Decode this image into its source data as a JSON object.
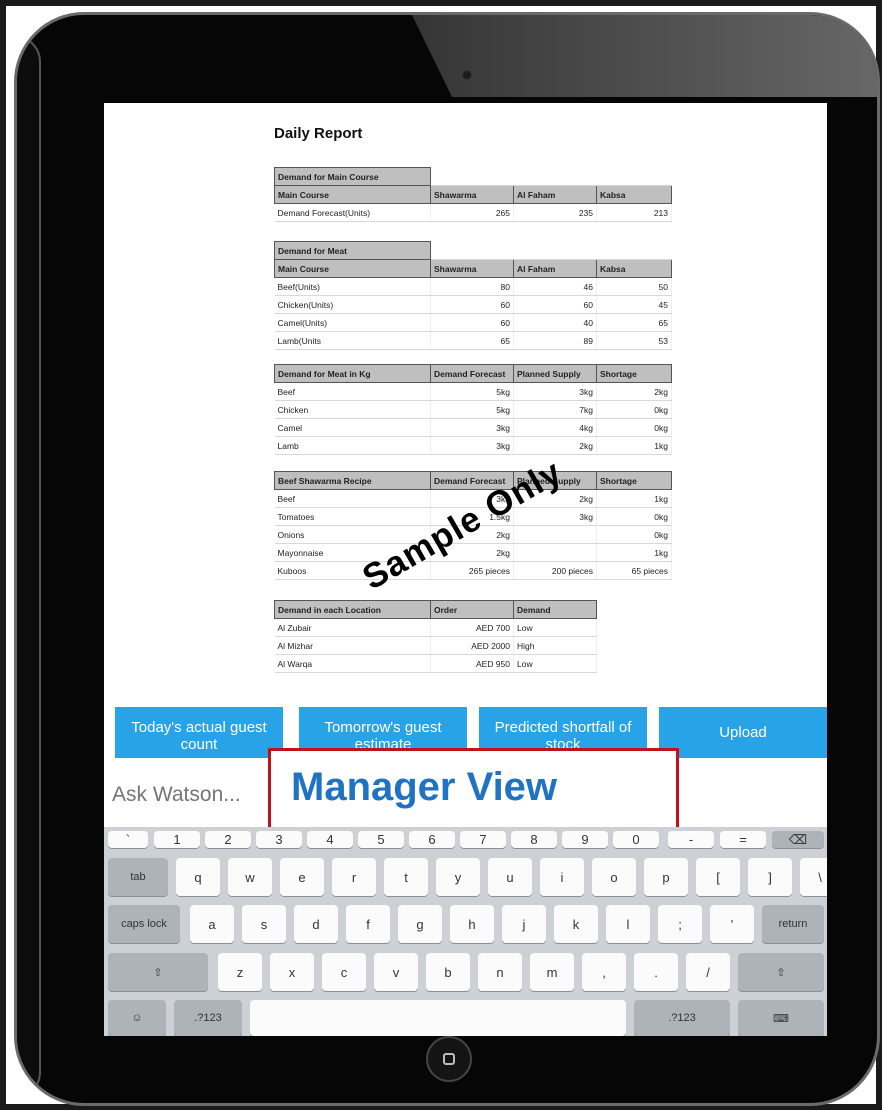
{
  "report": {
    "title": "Daily Report",
    "tables": [
      {
        "group": "Demand for Main Course",
        "headers": [
          "Main Course",
          "Shawarma",
          "Al Faham",
          "Kabsa"
        ],
        "rows": [
          [
            "Demand Forecast(Units)",
            "265",
            "235",
            "213"
          ]
        ]
      },
      {
        "group": "Demand for Meat",
        "headers": [
          "Main Course",
          "Shawarma",
          "Al Faham",
          "Kabsa"
        ],
        "rows": [
          [
            "Beef(Units)",
            "80",
            "46",
            "50"
          ],
          [
            "Chicken(Units)",
            "60",
            "60",
            "45"
          ],
          [
            "Camel(Units)",
            "60",
            "40",
            "65"
          ],
          [
            "Lamb(Units",
            "65",
            "89",
            "53"
          ]
        ]
      },
      {
        "headers": [
          "Demand for Meat in Kg",
          "Demand Forecast",
          "Planned Supply",
          "Shortage"
        ],
        "rows": [
          [
            "Beef",
            "5kg",
            "3kg",
            "2kg"
          ],
          [
            "Chicken",
            "5kg",
            "7kg",
            "0kg"
          ],
          [
            "Camel",
            "3kg",
            "4kg",
            "0kg"
          ],
          [
            "Lamb",
            "3kg",
            "2kg",
            "1kg"
          ]
        ]
      },
      {
        "headers": [
          "Beef Shawarma Recipe",
          "Demand Forecast",
          "Planned Supply",
          "Shortage"
        ],
        "rows": [
          [
            "Beef",
            "3kg",
            "2kg",
            "1kg"
          ],
          [
            "Tomatoes",
            "1.5kg",
            "3kg",
            "0kg"
          ],
          [
            "Onions",
            "2kg",
            "",
            "0kg"
          ],
          [
            "Mayonnaise",
            "2kg",
            "",
            "1kg"
          ],
          [
            "Kuboos",
            "265 pieces",
            "200 pieces",
            "65 pieces"
          ]
        ]
      },
      {
        "headers": [
          "Demand in each Location",
          "Order",
          "Demand"
        ],
        "rows": [
          [
            "Al Zubair",
            "AED   700",
            "Low"
          ],
          [
            "Al Mizhar",
            "AED 2000",
            "High"
          ],
          [
            "Al Warqa",
            "AED   950",
            "Low"
          ]
        ]
      }
    ],
    "watermark": "Sample Only"
  },
  "actions": [
    {
      "label": "Today's actual guest count"
    },
    {
      "label": "Tomorrow's guest estimate"
    },
    {
      "label": "Predicted shortfall of stock"
    },
    {
      "label": "Upload"
    }
  ],
  "ask": {
    "placeholder": "Ask Watson..."
  },
  "overlay_label": "Manager View",
  "keyboard": {
    "number_row": [
      "`",
      "1",
      "2",
      "3",
      "4",
      "5",
      "6",
      "7",
      "8",
      "9",
      "0",
      "-",
      "=",
      "⌫"
    ],
    "row1": [
      "tab",
      "q",
      "w",
      "e",
      "r",
      "t",
      "y",
      "u",
      "i",
      "o",
      "p",
      "[",
      "]",
      "\\"
    ],
    "row2": [
      "caps lock",
      "a",
      "s",
      "d",
      "f",
      "g",
      "h",
      "j",
      "k",
      "l",
      ";",
      "'",
      "return"
    ],
    "row3": [
      "⇧",
      "z",
      "x",
      "c",
      "v",
      "b",
      "n",
      "m",
      ",",
      ".",
      "/",
      "⇧"
    ],
    "row4": [
      "☺",
      ".?123",
      "",
      ".?123",
      "⌨"
    ]
  }
}
